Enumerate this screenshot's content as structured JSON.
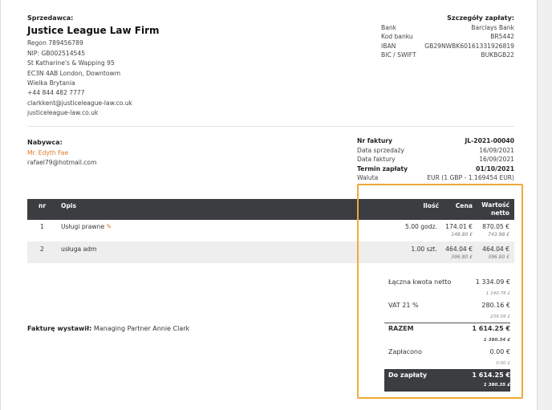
{
  "seller": {
    "label": "Sprzedawca:",
    "name": "Justice League Law Firm",
    "lines": [
      "Regon 789456789",
      "NIP: GB002514545",
      "St Katharine's & Wapping 95",
      "EC3N 4AB London, Downtowm",
      "Wielka Brytania",
      "+44 844 482 7777",
      "clarkkent@justiceleague-law.co.uk",
      "justiceleague-law.co.uk"
    ]
  },
  "payment": {
    "title": "Szczegóły zapłaty:",
    "rows": [
      {
        "k": "Bank",
        "v": "Barclays Bank"
      },
      {
        "k": "Kod banku",
        "v": "BR5442"
      },
      {
        "k": "IBAN",
        "v": "GB29NWBK60161331926819"
      },
      {
        "k": "BIC / SWIFT",
        "v": "BUKBGB22"
      }
    ]
  },
  "buyer": {
    "label": "Nabywca:",
    "name": "Mr. Edyth Fae",
    "email": "rafael79@hotmail.com"
  },
  "invoice": {
    "number_label": "Nr faktury",
    "number": "JL-2021-00040",
    "sale_date_label": "Data sprzedaży",
    "sale_date": "16/09/2021",
    "invoice_date_label": "Data faktury",
    "invoice_date": "16/09/2021",
    "due_label": "Termin zapłaty",
    "due": "01/10/2021",
    "currency_label": "Waluta",
    "currency": "EUR (1 GBP - 1.169454 EUR)"
  },
  "table": {
    "headers": {
      "nr": "nr",
      "desc": "Opis",
      "qty": "Ilość",
      "price": "Cena",
      "value1": "Wartość",
      "value2": "netto"
    },
    "rows": [
      {
        "nr": "1",
        "desc": "Usługi prawne",
        "qty": "5.00 godz.",
        "price": "174.01 €",
        "price_sub": "148.80 £",
        "value": "870.05 €",
        "value_sub": "743.98 £"
      },
      {
        "nr": "2",
        "desc": "usługa adm",
        "qty": "1.00 szt.",
        "price": "464.04 €",
        "price_sub": "396.80 £",
        "value": "464.04 €",
        "value_sub": "396.80 £"
      }
    ]
  },
  "issuer": {
    "label": "Fakturę wystawił:",
    "name": "Managing Partner Annie Clark"
  },
  "totals": {
    "net_label": "Łączna kwota netto",
    "net": "1 334.09 €",
    "net_sub": "1 140.78 £",
    "vat_label": "VAT 21 %",
    "vat": "280.16 €",
    "vat_sub": "239.56 £",
    "sum_label": "RAZEM",
    "sum": "1 614.25 €",
    "sum_sub": "1 380.34 £",
    "paid_label": "Zapłacono",
    "paid": "0.00 €",
    "paid_sub": "0.00 £",
    "due_label": "Do zapłaty",
    "due": "1 614.25 €",
    "due_sub": "1 380.35 £"
  },
  "colors": {
    "accent": "#e0782a",
    "header_bg": "#3b3d40",
    "highlight": "#f0a93a"
  }
}
